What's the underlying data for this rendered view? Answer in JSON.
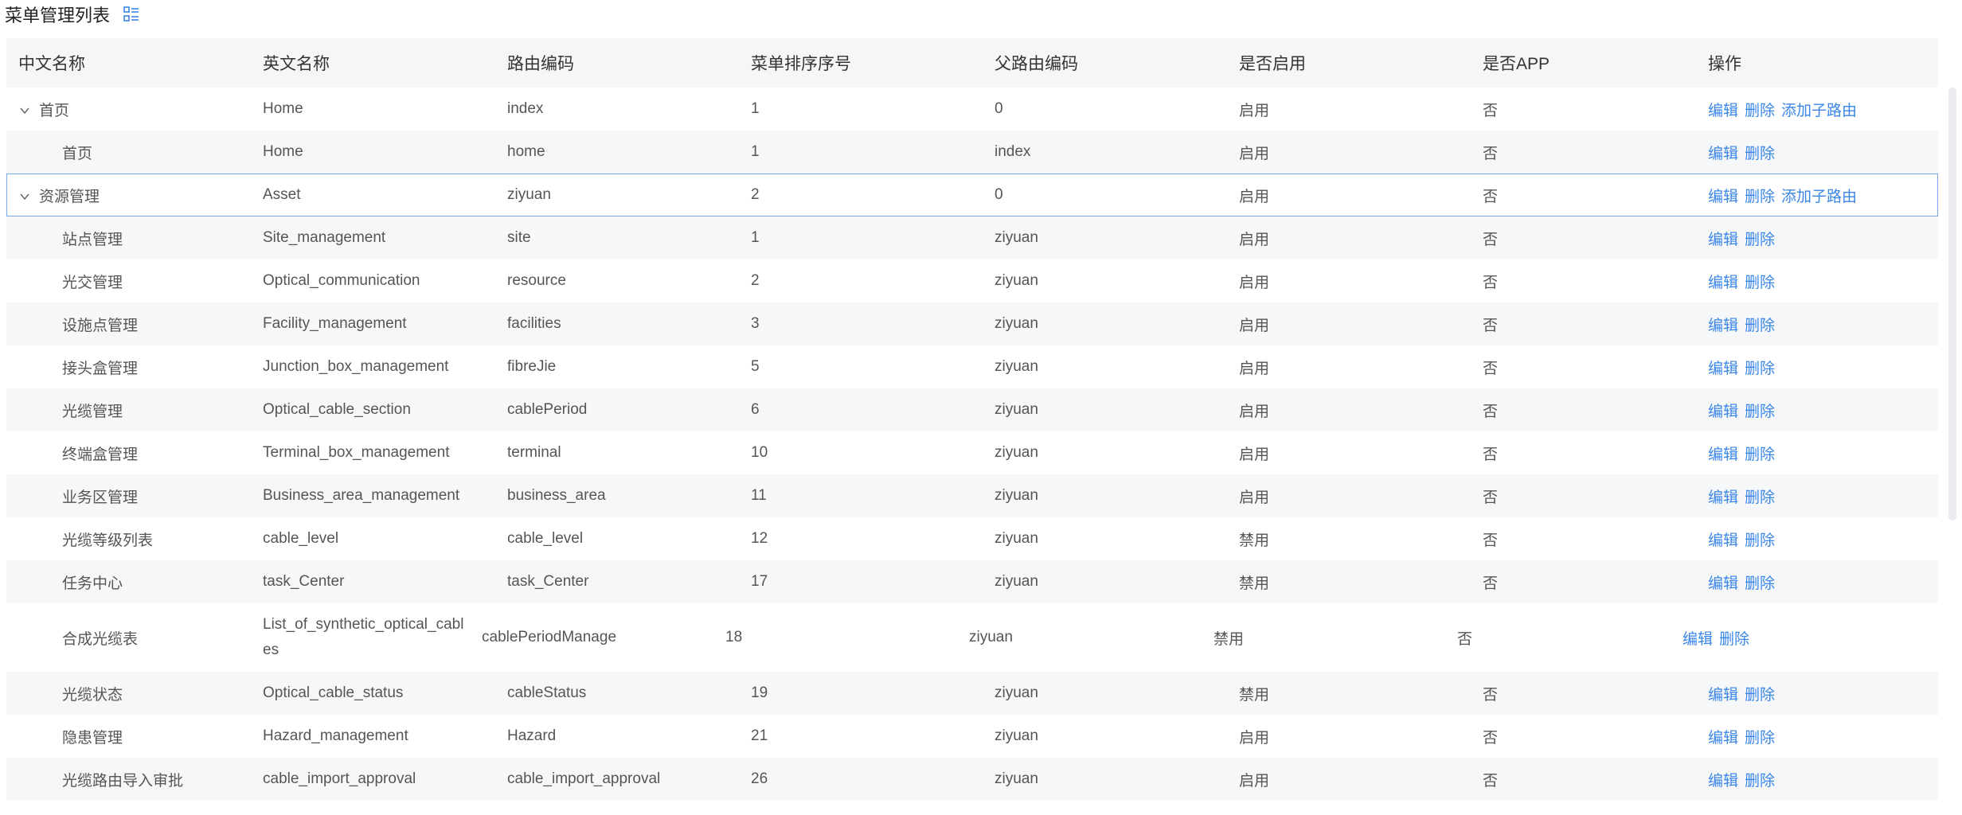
{
  "page": {
    "title": "菜单管理列表",
    "title_icon": "column-settings-icon",
    "accent_color": "#3a86e8"
  },
  "table": {
    "headers": [
      "中文名称",
      "英文名称",
      "路由编码",
      "菜单排序序号",
      "父路由编码",
      "是否启用",
      "是否APP",
      "操作"
    ],
    "actions": {
      "edit": "编辑",
      "delete": "删除",
      "add_child": "添加子路由"
    },
    "rows": [
      {
        "cn": "首页",
        "en": "Home",
        "code": "index",
        "order": "1",
        "parent": "0",
        "enabled": "启用",
        "app": "否",
        "level": 0,
        "expanded": true,
        "add_child": true
      },
      {
        "cn": "首页",
        "en": "Home",
        "code": "home",
        "order": "1",
        "parent": "index",
        "enabled": "启用",
        "app": "否",
        "level": 1,
        "expanded": false,
        "add_child": false
      },
      {
        "cn": "资源管理",
        "en": "Asset",
        "code": "ziyuan",
        "order": "2",
        "parent": "0",
        "enabled": "启用",
        "app": "否",
        "level": 0,
        "expanded": true,
        "add_child": true,
        "selected": true
      },
      {
        "cn": "站点管理",
        "en": "Site_management",
        "code": "site",
        "order": "1",
        "parent": "ziyuan",
        "enabled": "启用",
        "app": "否",
        "level": 1,
        "add_child": false
      },
      {
        "cn": "光交管理",
        "en": "Optical_communication",
        "code": "resource",
        "order": "2",
        "parent": "ziyuan",
        "enabled": "启用",
        "app": "否",
        "level": 1,
        "add_child": false
      },
      {
        "cn": "设施点管理",
        "en": "Facility_management",
        "code": "facilities",
        "order": "3",
        "parent": "ziyuan",
        "enabled": "启用",
        "app": "否",
        "level": 1,
        "add_child": false
      },
      {
        "cn": "接头盒管理",
        "en": "Junction_box_management",
        "code": "fibreJie",
        "order": "5",
        "parent": "ziyuan",
        "enabled": "启用",
        "app": "否",
        "level": 1,
        "add_child": false
      },
      {
        "cn": "光缆管理",
        "en": "Optical_cable_section",
        "code": "cablePeriod",
        "order": "6",
        "parent": "ziyuan",
        "enabled": "启用",
        "app": "否",
        "level": 1,
        "add_child": false
      },
      {
        "cn": "终端盒管理",
        "en": "Terminal_box_management",
        "code": "terminal",
        "order": "10",
        "parent": "ziyuan",
        "enabled": "启用",
        "app": "否",
        "level": 1,
        "add_child": false
      },
      {
        "cn": "业务区管理",
        "en": "Business_area_management",
        "code": "business_area",
        "order": "11",
        "parent": "ziyuan",
        "enabled": "启用",
        "app": "否",
        "level": 1,
        "add_child": false
      },
      {
        "cn": "光缆等级列表",
        "en": "cable_level",
        "code": "cable_level",
        "order": "12",
        "parent": "ziyuan",
        "enabled": "禁用",
        "app": "否",
        "level": 1,
        "add_child": false
      },
      {
        "cn": "任务中心",
        "en": "task_Center",
        "code": "task_Center",
        "order": "17",
        "parent": "ziyuan",
        "enabled": "禁用",
        "app": "否",
        "level": 1,
        "add_child": false
      },
      {
        "cn": "合成光缆表",
        "en": "List_of_synthetic_optical_cables",
        "code": "cablePeriodManage",
        "order": "18",
        "parent": "ziyuan",
        "enabled": "禁用",
        "app": "否",
        "level": 1,
        "add_child": false,
        "tall": true
      },
      {
        "cn": "光缆状态",
        "en": "Optical_cable_status",
        "code": "cableStatus",
        "order": "19",
        "parent": "ziyuan",
        "enabled": "禁用",
        "app": "否",
        "level": 1,
        "add_child": false
      },
      {
        "cn": "隐患管理",
        "en": "Hazard_management",
        "code": "Hazard",
        "order": "21",
        "parent": "ziyuan",
        "enabled": "启用",
        "app": "否",
        "level": 1,
        "add_child": false
      },
      {
        "cn": "光缆路由导入审批",
        "en": "cable_import_approval",
        "code": "cable_import_approval",
        "order": "26",
        "parent": "ziyuan",
        "enabled": "启用",
        "app": "否",
        "level": 1,
        "add_child": false
      }
    ]
  }
}
